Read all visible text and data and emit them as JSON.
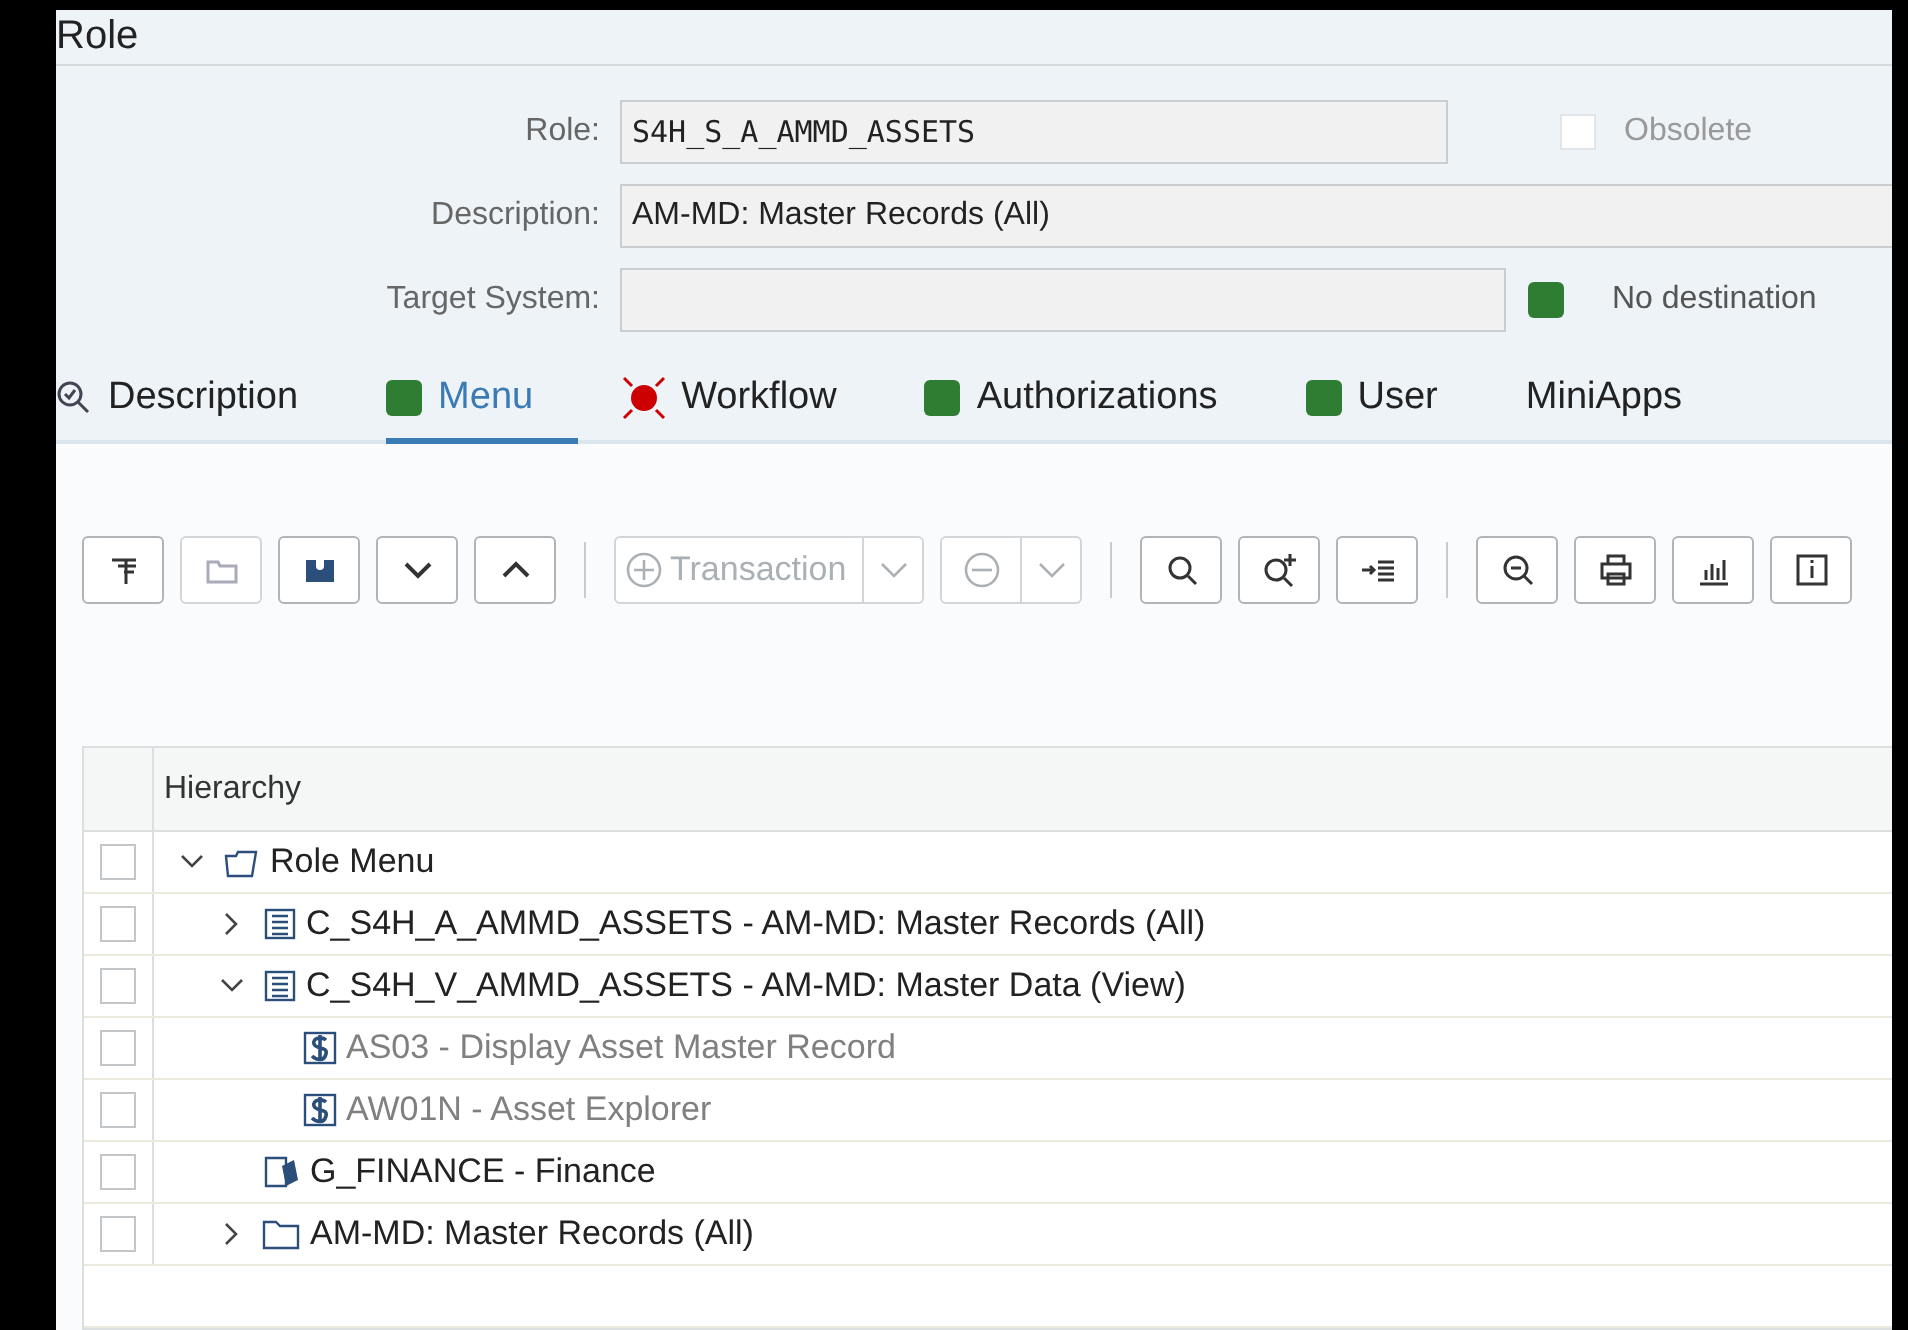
{
  "title": "Role",
  "form": {
    "role_label": "Role:",
    "role_value": "S4H_S_A_AMMD_ASSETS",
    "obsolete_label": "Obsolete",
    "obsolete_checked": false,
    "description_label": "Description:",
    "description_value": "AM-MD: Master Records (All)",
    "target_label": "Target System:",
    "destination_ok": true,
    "destination_text": "No destination"
  },
  "tabs": [
    {
      "label": "Description",
      "kind": "search",
      "selected": false
    },
    {
      "label": "Menu",
      "kind": "ok",
      "selected": true
    },
    {
      "label": "Workflow",
      "kind": "error",
      "selected": false
    },
    {
      "label": "Authorizations",
      "kind": "ok",
      "selected": false
    },
    {
      "label": "User",
      "kind": "ok",
      "selected": false
    },
    {
      "label": "MiniApps",
      "kind": "none",
      "selected": false
    }
  ],
  "toolbar": [
    {
      "kind": "icon",
      "disabled": false
    },
    {
      "kind": "icon",
      "disabled": true
    },
    {
      "kind": "icon",
      "disabled": false
    },
    {
      "kind": "icon",
      "disabled": false
    },
    {
      "kind": "icon",
      "disabled": false
    },
    {
      "kind": "split",
      "label": "Transaction",
      "disabled": true
    },
    {
      "kind": "split",
      "disabled": true
    },
    {
      "kind": "icon",
      "disabled": false
    },
    {
      "kind": "icon",
      "disabled": false
    },
    {
      "kind": "icon",
      "disabled": false
    },
    {
      "kind": "icon",
      "disabled": false
    },
    {
      "kind": "icon",
      "disabled": false
    },
    {
      "kind": "icon",
      "disabled": false
    },
    {
      "kind": "icon",
      "disabled": false
    }
  ],
  "table": {
    "columns": [
      "Hierarchy"
    ],
    "rows": [
      {
        "label": "Role Menu",
        "kind": "root",
        "expanded": true,
        "checked": false,
        "disabled": false,
        "children": [
          {
            "label": "C_S4H_A_AMMD_ASSETS - AM-MD: Master Records (All)",
            "kind": "role",
            "expanded": false,
            "checked": false,
            "disabled": false
          },
          {
            "label": "C_S4H_V_AMMD_ASSETS - AM-MD: Master Data (View)",
            "kind": "role",
            "expanded": true,
            "checked": false,
            "disabled": false,
            "children": [
              {
                "label": "AS03 - Display Asset Master Record",
                "kind": "transaction",
                "checked": false,
                "disabled": true
              },
              {
                "label": "AW01N - Asset Explorer",
                "kind": "transaction",
                "checked": false,
                "disabled": true
              }
            ]
          },
          {
            "label": "G_FINANCE - Finance",
            "kind": "report",
            "checked": false,
            "disabled": false
          },
          {
            "label": "AM-MD: Master Records (All)",
            "kind": "folder",
            "expanded": false,
            "checked": false,
            "disabled": false
          }
        ]
      }
    ]
  }
}
